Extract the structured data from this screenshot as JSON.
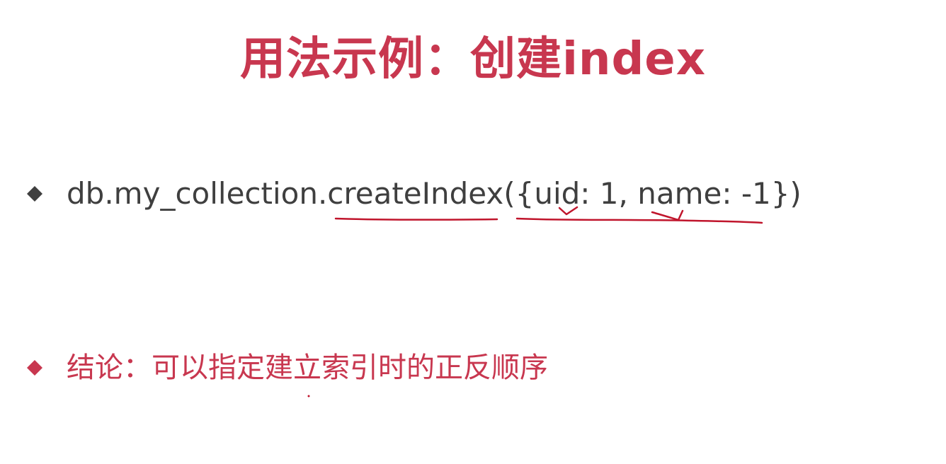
{
  "title": "用法示例：创建index",
  "bullets": {
    "code": "db.my_collection.createIndex({uid: 1, name: -1})",
    "conclusion": "结论：可以指定建立索引时的正反顺序"
  },
  "colors": {
    "accent": "#c8374f",
    "body_text": "#3f3f3f",
    "bullet_dark": "#3f3f3f",
    "annotation": "#c0152c"
  },
  "icons": {
    "bullet_1": "diamond-bullet-icon",
    "bullet_2": "diamond-bullet-icon"
  }
}
